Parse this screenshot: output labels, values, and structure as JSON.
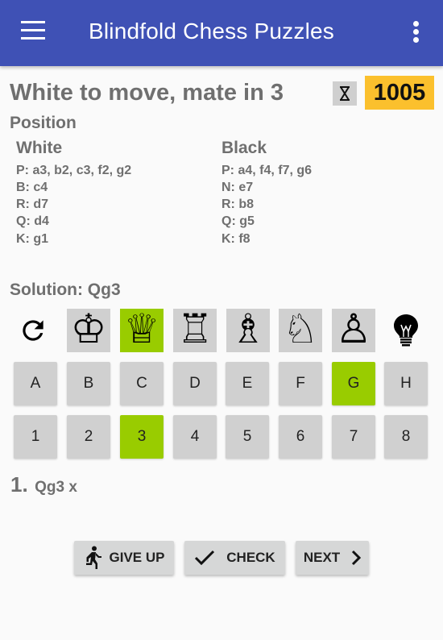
{
  "appbar": {
    "title": "Blindfold Chess Puzzles",
    "menu_icon": "hamburger-menu-icon",
    "overflow_icon": "more-vert-icon",
    "color": "#3f51b5"
  },
  "puzzle": {
    "headline": "White to move, mate in 3",
    "timer_icon": "hourglass-icon",
    "score": "1005",
    "score_color": "#fbc02d"
  },
  "position": {
    "label": "Position",
    "white": {
      "title": "White",
      "lines": [
        "P: a3, b2, c3, f2, g2",
        "B: c4",
        "R: d7",
        "Q: d4",
        "K: g1"
      ]
    },
    "black": {
      "title": "Black",
      "lines": [
        "P: a4, f4, f7, g6",
        "N: e7",
        "R: b8",
        "Q: g5",
        "K: f8"
      ]
    }
  },
  "solution": {
    "label": "Solution: Qg3"
  },
  "pieces": {
    "reset_icon": "refresh-icon",
    "hint_icon": "lightbulb-icon",
    "items": [
      {
        "name": "king",
        "glyph": "♔",
        "active": false
      },
      {
        "name": "queen",
        "glyph": "♕",
        "active": true
      },
      {
        "name": "rook",
        "glyph": "♖",
        "active": false
      },
      {
        "name": "bishop",
        "glyph": "♗",
        "active": false
      },
      {
        "name": "knight",
        "glyph": "♘",
        "active": false
      },
      {
        "name": "pawn",
        "glyph": "♙",
        "active": false
      }
    ]
  },
  "files": {
    "items": [
      "A",
      "B",
      "C",
      "D",
      "E",
      "F",
      "G",
      "H"
    ],
    "selected": "G"
  },
  "ranks": {
    "items": [
      "1",
      "2",
      "3",
      "4",
      "5",
      "6",
      "7",
      "8"
    ],
    "selected": "3"
  },
  "moves": {
    "number": "1.",
    "text": "Qg3 x"
  },
  "actions": {
    "give_up": "GIVE UP",
    "check": "CHECK",
    "next": "NEXT"
  },
  "colors": {
    "active_green": "#99cc00",
    "key_gray": "#d0d0d0"
  }
}
